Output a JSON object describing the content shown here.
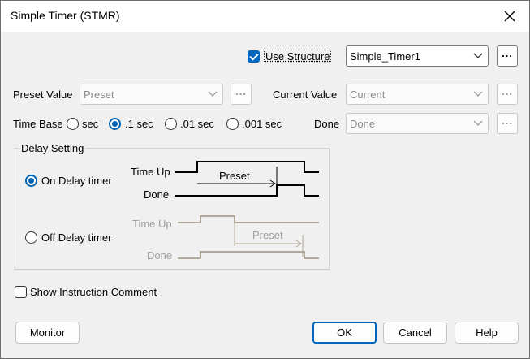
{
  "window": {
    "title": "Simple Timer (STMR)"
  },
  "icons": {
    "close": "close-icon",
    "dropdown": "chevron-down-icon"
  },
  "use_structure": {
    "label": "Use Structure",
    "checked": true,
    "value": "Simple_Timer1",
    "ellipsis": "..."
  },
  "preset": {
    "label": "Preset Value",
    "value": "Preset",
    "ellipsis": "..."
  },
  "current": {
    "label": "Current Value",
    "value": "Current",
    "ellipsis": "..."
  },
  "time_base": {
    "label": "Time Base",
    "options": [
      "sec",
      ".1 sec",
      ".01 sec",
      ".001 sec"
    ],
    "selected": ".1 sec"
  },
  "done": {
    "label": "Done",
    "value": "Done",
    "ellipsis": "..."
  },
  "delay": {
    "title": "Delay Setting",
    "on_delay": {
      "label": "On Delay timer",
      "selected": true,
      "time_up": "Time Up",
      "done": "Done",
      "preset": "Preset"
    },
    "off_delay": {
      "label": "Off Delay timer",
      "selected": false,
      "time_up": "Time Up",
      "done": "Done",
      "preset": "Preset"
    }
  },
  "show_comment": {
    "label": "Show Instruction Comment",
    "checked": false
  },
  "buttons": {
    "monitor": "Monitor",
    "ok": "OK",
    "cancel": "Cancel",
    "help": "Help"
  },
  "colors": {
    "accent": "#0067c0",
    "disabled_text": "#8a8a8a"
  }
}
